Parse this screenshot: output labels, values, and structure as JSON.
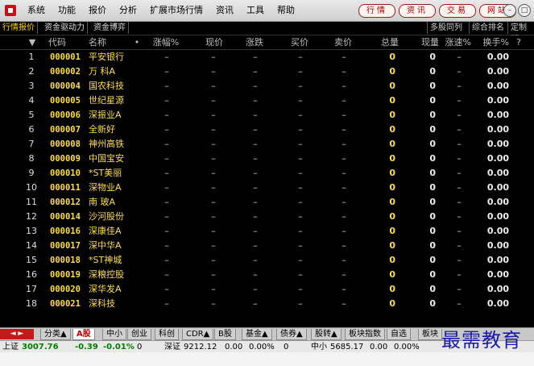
{
  "menubar": {
    "items": [
      "系统",
      "功能",
      "报价",
      "分析",
      "扩展市场行情",
      "资讯",
      "工具",
      "帮助"
    ],
    "pills": [
      "行情",
      "资讯",
      "交易",
      "网站"
    ]
  },
  "tabs": {
    "left": [
      "行情报价",
      "资金驱动力",
      "资金博弈"
    ],
    "right": [
      "多股同列",
      "综合排名",
      "定制版"
    ]
  },
  "table": {
    "headers": [
      "▼",
      "代码",
      "名称",
      "•",
      "涨幅%",
      "现价",
      "涨跌",
      "买价",
      "卖价",
      "总量",
      "现量",
      "涨速%",
      "换手%",
      "?"
    ],
    "rows": [
      {
        "idx": "1",
        "code": "000001",
        "name": "平安银行",
        "hand": "0.00"
      },
      {
        "idx": "2",
        "code": "000002",
        "name": "万 科A",
        "hand": "0.00"
      },
      {
        "idx": "3",
        "code": "000004",
        "name": "国农科技",
        "hand": "0.00"
      },
      {
        "idx": "4",
        "code": "000005",
        "name": "世纪星源",
        "hand": "0.00"
      },
      {
        "idx": "5",
        "code": "000006",
        "name": "深振业A",
        "hand": "0.00"
      },
      {
        "idx": "6",
        "code": "000007",
        "name": "全新好",
        "hand": "0.00"
      },
      {
        "idx": "7",
        "code": "000008",
        "name": "神州高铁",
        "hand": "0.00"
      },
      {
        "idx": "8",
        "code": "000009",
        "name": "中国宝安",
        "hand": "0.00"
      },
      {
        "idx": "9",
        "code": "000010",
        "name": "*ST美丽",
        "hand": "0.00"
      },
      {
        "idx": "10",
        "code": "000011",
        "name": "深物业A",
        "hand": "0.00"
      },
      {
        "idx": "11",
        "code": "000012",
        "name": "南 玻A",
        "hand": "0.00"
      },
      {
        "idx": "12",
        "code": "000014",
        "name": "沙河股份",
        "hand": "0.00"
      },
      {
        "idx": "13",
        "code": "000016",
        "name": "深康佳A",
        "hand": "0.00"
      },
      {
        "idx": "14",
        "code": "000017",
        "name": "深中华A",
        "hand": "0.00"
      },
      {
        "idx": "15",
        "code": "000018",
        "name": "*ST神城",
        "hand": "0.00"
      },
      {
        "idx": "16",
        "code": "000019",
        "name": "深粮控股",
        "hand": "0.00"
      },
      {
        "idx": "17",
        "code": "000020",
        "name": "深华发A",
        "hand": "0.00"
      },
      {
        "idx": "18",
        "code": "000021",
        "name": "深科技",
        "hand": "0.00"
      }
    ],
    "dash": "–",
    "zero": "0"
  },
  "bottom_tabs": {
    "arrows": "◄ ►",
    "items": [
      "分类▲",
      "A股",
      "中小",
      "创业",
      "科创",
      "CDR▲",
      "B股",
      "基金▲",
      "债券▲",
      "股转▲",
      "板块指数",
      "自选",
      "板块"
    ]
  },
  "status": {
    "sh_label": "上证",
    "sh_value": "3007.76",
    "sh_change": "-0.39",
    "sh_pct": "-0.01%",
    "sh_vol": "0",
    "sz_label": "深证",
    "sz_value": "9212.12",
    "sz_change": "0.00",
    "sz_pct": "0.00%",
    "sz_vol": "0",
    "zx_label": "中小",
    "zx_value": "5685.17",
    "zx_change": "0.00",
    "zx_pct": "0.00%"
  },
  "watermark": "最需教育"
}
